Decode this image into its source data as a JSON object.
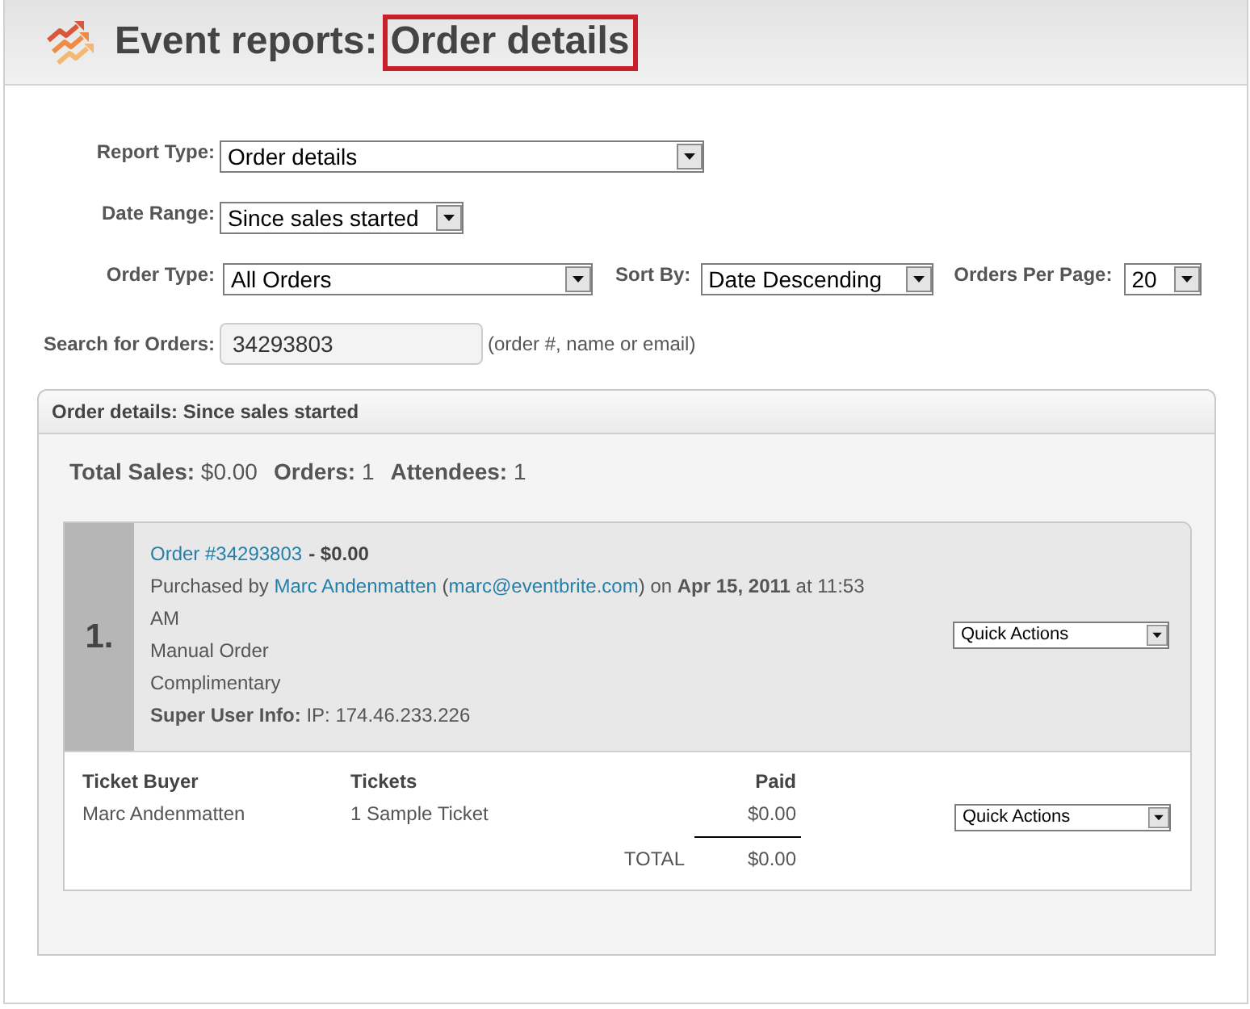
{
  "header": {
    "title": "Event reports:",
    "subtitle": "Order details",
    "subtitle_highlighted": true
  },
  "filters": [
    [
      {
        "label": "Report Type:",
        "value": "Order details"
      }
    ],
    [
      {
        "label": "Date Range:",
        "value": "Since sales started"
      }
    ],
    [
      {
        "label": "Order Type:",
        "value": "All Orders"
      },
      {
        "label": "Sort By:",
        "value": "Date Descending"
      },
      {
        "label": "Orders Per Page:",
        "value": "20"
      }
    ]
  ],
  "search": {
    "label": "Search for Orders:",
    "value": "34293803",
    "hint": "(order #, name or email)"
  },
  "results_panel": {
    "title": "Order details: Since sales started",
    "summary": [
      "**Total Sales:** $0.00",
      "**Orders:** 1",
      "**Attendees:** 1"
    ],
    "orders": [
      {
        "number": "1.",
        "order_link": "Order #34293803",
        "amount": "- $0.00",
        "purchase_info": [
          {
            "kind": "text",
            "text": "Purchased by "
          },
          {
            "kind": "name_link",
            "text": "Marc Andenmatten"
          },
          {
            "kind": "text",
            "text": " ("
          },
          {
            "kind": "email_link",
            "text": "marc@eventbrite.com"
          },
          {
            "kind": "text",
            "text": ") on **Apr 15, 2011** at 11:53 AM"
          }
        ],
        "lines": [
          "Manual Order",
          "Complimentary",
          "**Super User Info:** IP: 174.46.233.226"
        ],
        "quick_actions": "Quick Actions",
        "tickets": {
          "columns": [
            "Ticket Buyer",
            "Tickets",
            "Paid"
          ],
          "rows": [
            [
              "Marc Andenmatten",
              "1 Sample Ticket",
              "$0.00"
            ]
          ],
          "total_label": "TOTAL",
          "total_value": "$0.00"
        },
        "ticket_quick_actions": "Quick Actions"
      }
    ]
  }
}
